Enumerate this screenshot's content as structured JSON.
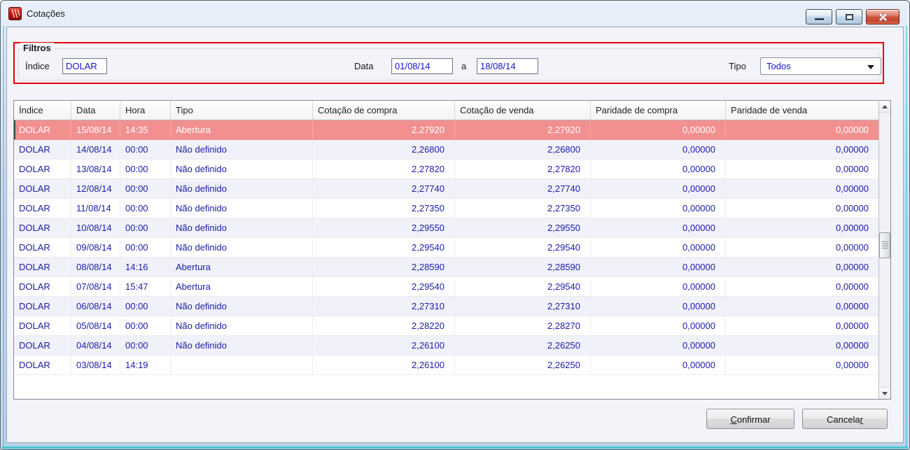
{
  "window": {
    "title": "Cotações",
    "controls": {
      "minimize": "minimize",
      "maximize": "maximize",
      "close": "close"
    }
  },
  "filters": {
    "group_label": "Filtros",
    "indice_label": "Índice",
    "indice_value": "DOLAR",
    "data_label": "Data",
    "data_from": "01/08/14",
    "range_separator": "a",
    "data_to": "18/08/14",
    "tipo_label": "Tipo",
    "tipo_value": "Todos"
  },
  "table": {
    "columns": [
      "Índice",
      "Data",
      "Hora",
      "Tipo",
      "Cotação de compra",
      "Cotação de venda",
      "Paridade de compra",
      "Paridade de venda"
    ],
    "rows": [
      {
        "selected": true,
        "cells": [
          "DOLAR",
          "15/08/14",
          "14:35",
          "Abertura",
          "2,27920",
          "2,27920",
          "0,00000",
          "0,00000"
        ]
      },
      {
        "selected": false,
        "cells": [
          "DOLAR",
          "14/08/14",
          "00:00",
          "Não definido",
          "2,26800",
          "2,26800",
          "0,00000",
          "0,00000"
        ]
      },
      {
        "selected": false,
        "cells": [
          "DOLAR",
          "13/08/14",
          "00:00",
          "Não definido",
          "2,27820",
          "2,27820",
          "0,00000",
          "0,00000"
        ]
      },
      {
        "selected": false,
        "cells": [
          "DOLAR",
          "12/08/14",
          "00:00",
          "Não definido",
          "2,27740",
          "2,27740",
          "0,00000",
          "0,00000"
        ]
      },
      {
        "selected": false,
        "cells": [
          "DOLAR",
          "11/08/14",
          "00:00",
          "Não definido",
          "2,27350",
          "2,27350",
          "0,00000",
          "0,00000"
        ]
      },
      {
        "selected": false,
        "cells": [
          "DOLAR",
          "10/08/14",
          "00:00",
          "Não definido",
          "2,29550",
          "2,29550",
          "0,00000",
          "0,00000"
        ]
      },
      {
        "selected": false,
        "cells": [
          "DOLAR",
          "09/08/14",
          "00:00",
          "Não definido",
          "2,29540",
          "2,29540",
          "0,00000",
          "0,00000"
        ]
      },
      {
        "selected": false,
        "cells": [
          "DOLAR",
          "08/08/14",
          "14:16",
          "Abertura",
          "2,28590",
          "2,28590",
          "0,00000",
          "0,00000"
        ]
      },
      {
        "selected": false,
        "cells": [
          "DOLAR",
          "07/08/14",
          "15:47",
          "Abertura",
          "2,29540",
          "2,29540",
          "0,00000",
          "0,00000"
        ]
      },
      {
        "selected": false,
        "cells": [
          "DOLAR",
          "06/08/14",
          "00:00",
          "Não definido",
          "2,27310",
          "2,27310",
          "0,00000",
          "0,00000"
        ]
      },
      {
        "selected": false,
        "cells": [
          "DOLAR",
          "05/08/14",
          "00:00",
          "Não definido",
          "2,28220",
          "2,28270",
          "0,00000",
          "0,00000"
        ]
      },
      {
        "selected": false,
        "cells": [
          "DOLAR",
          "04/08/14",
          "00:00",
          "Não definido",
          "2,26100",
          "2,26250",
          "0,00000",
          "0,00000"
        ]
      },
      {
        "selected": false,
        "cells": [
          "DOLAR",
          "03/08/14",
          "14:19",
          "",
          "2,26100",
          "2,26250",
          "0,00000",
          "0,00000"
        ]
      }
    ]
  },
  "buttons": [
    {
      "id": "btn-confirm",
      "name": "confirm-button",
      "label": "Confirmar",
      "accel_index": 0
    },
    {
      "id": "btn-cancel",
      "name": "cancel-button",
      "label": "Cancelar",
      "accel_index": 7
    }
  ],
  "colors": {
    "selected_row": "#f29090",
    "filter_highlight": "#e60000",
    "cell_text": "#1c1ca8",
    "input_text": "#1414cc"
  }
}
